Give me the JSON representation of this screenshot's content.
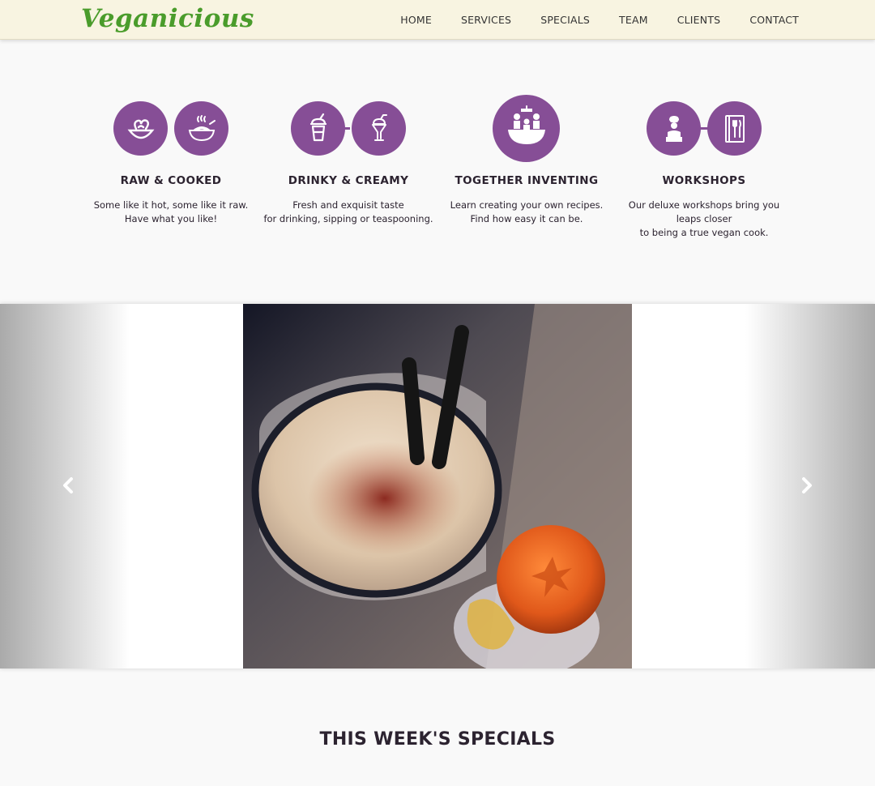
{
  "brand": {
    "name": "Veganicious",
    "color": "#4a9c2b"
  },
  "nav": {
    "items": [
      {
        "label": "HOME"
      },
      {
        "label": "SERVICES"
      },
      {
        "label": "SPECIALS"
      },
      {
        "label": "TEAM"
      },
      {
        "label": "CLIENTS"
      },
      {
        "label": "CONTACT"
      }
    ]
  },
  "accent_color": "#864e96",
  "services": [
    {
      "title": "RAW & COOKED",
      "lines": [
        "Some like it hot, some like it raw.",
        "Have what you like!"
      ],
      "icons": [
        "cooked-bowl-icon",
        "noodle-bowl-icon"
      ]
    },
    {
      "title": "DRINKY & CREAMY",
      "lines": [
        "Fresh and exquisit taste",
        "for drinking, sipping or teaspooning."
      ],
      "icons": [
        "drink-cup-icon",
        "milkshake-icon"
      ]
    },
    {
      "title": "TOGETHER INVENTING",
      "lines": [
        "Learn creating your own recipes.",
        "Find how easy it can be."
      ],
      "icons": [
        "cooking-together-icon"
      ]
    },
    {
      "title": "WORKSHOPS",
      "lines": [
        "Our deluxe workshops bring you",
        "leaps closer",
        "to being a true vegan cook."
      ],
      "icons": [
        "chef-icon",
        "recipe-book-icon"
      ]
    }
  ],
  "carousel": {
    "prev_icon": "chevron-left-icon",
    "next_icon": "chevron-right-icon"
  },
  "specials": {
    "title": "THIS WEEK'S SPECIALS"
  }
}
